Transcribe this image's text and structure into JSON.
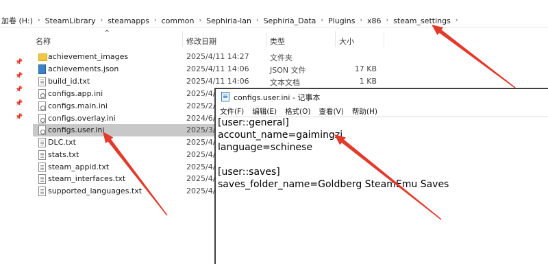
{
  "explorer": {
    "breadcrumbs": [
      "加卷 (H:)",
      "SteamLibrary",
      "steamapps",
      "common",
      "Sephiria-lan",
      "Sephiria_Data",
      "Plugins",
      "x86",
      "steam_settings"
    ],
    "columns": {
      "name": "名称",
      "date": "修改日期",
      "type": "类型",
      "size": "大小"
    },
    "files": [
      {
        "name": "achievement_images",
        "date": "2025/4/11 14:27",
        "type": "文件夹",
        "size": "",
        "icon": "folder-icon"
      },
      {
        "name": "achievements.json",
        "date": "2025/4/11 14:06",
        "type": "JSON 文件",
        "size": "17 KB",
        "icon": "json-file-icon"
      },
      {
        "name": "build_id.txt",
        "date": "2025/4/11 14:06",
        "type": "文本文档",
        "size": "1 KB",
        "icon": "text-file-icon"
      },
      {
        "name": "configs.app.ini",
        "date": "2025/4/",
        "type": "",
        "size": "",
        "icon": "settings-file-icon"
      },
      {
        "name": "configs.main.ini",
        "date": "2025/2/",
        "type": "",
        "size": "",
        "icon": "settings-file-icon"
      },
      {
        "name": "configs.overlay.ini",
        "date": "2024/6/",
        "type": "",
        "size": "",
        "icon": "settings-file-icon"
      },
      {
        "name": "configs.user.ini",
        "date": "2025/3/",
        "type": "",
        "size": "",
        "icon": "settings-file-icon",
        "selected": true
      },
      {
        "name": "DLC.txt",
        "date": "2025/4/",
        "type": "",
        "size": "",
        "icon": "text-file-icon"
      },
      {
        "name": "stats.txt",
        "date": "2025/4/",
        "type": "",
        "size": "",
        "icon": "text-file-icon"
      },
      {
        "name": "steam_appid.txt",
        "date": "2025/4/",
        "type": "",
        "size": "",
        "icon": "text-file-icon"
      },
      {
        "name": "steam_interfaces.txt",
        "date": "2025/4/",
        "type": "",
        "size": "",
        "icon": "text-file-icon"
      },
      {
        "name": "supported_languages.txt",
        "date": "2025/4/",
        "type": "",
        "size": "",
        "icon": "text-file-icon"
      }
    ]
  },
  "notepad": {
    "title": "configs.user.ini - 记事本",
    "menu": [
      "文件(F)",
      "编辑(E)",
      "格式(O)",
      "查看(V)",
      "帮助(H)"
    ],
    "lines": [
      "[user::general]",
      "account_name=gaimingzi",
      "language=schinese",
      "",
      "[user::saves]",
      "saves_folder_name=Goldberg SteamEmu Saves"
    ]
  },
  "colors": {
    "arrow": "#e23a2b",
    "selected_row": "#c8c8c8",
    "folder": "#f3c641"
  }
}
